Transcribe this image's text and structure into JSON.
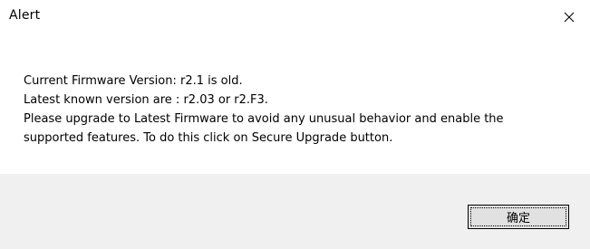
{
  "dialog": {
    "title": "Alert",
    "close_icon": "close-icon",
    "message": {
      "line1": "Current Firmware Version: r2.1 is old.",
      "line2": "Latest known version are : r2.03 or r2.F3.",
      "line3": "Please upgrade to Latest Firmware to avoid any unusual behavior and enable the",
      "line4": "supported features. To do this click on Secure Upgrade button."
    },
    "ok_label": "确定"
  },
  "colors": {
    "background": "#ffffff",
    "footer": "#f0f0f0",
    "button": "#e1e1e1",
    "text": "#000000"
  }
}
